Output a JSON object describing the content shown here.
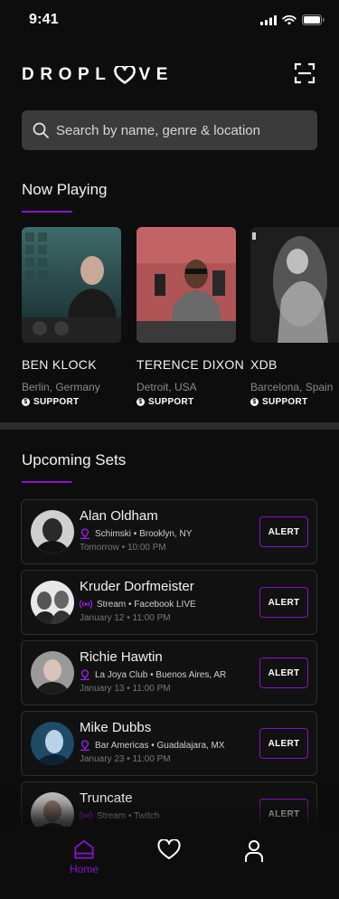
{
  "status_bar": {
    "time": "9:41"
  },
  "header": {
    "logo_text_left": "DROPL",
    "logo_text_right": "VE"
  },
  "search": {
    "placeholder": "Search by name, genre & location"
  },
  "now_playing": {
    "title": "Now Playing",
    "artists": [
      {
        "name": "BEN KLOCK",
        "location": "Berlin, Germany",
        "support_label": "SUPPORT"
      },
      {
        "name": "TERENCE DIXON",
        "location": "Detroit, USA",
        "support_label": "SUPPORT"
      },
      {
        "name": "XDB",
        "location": "Barcelona, Spain",
        "support_label": "SUPPORT"
      }
    ]
  },
  "upcoming_sets": {
    "title": "Upcoming Sets",
    "sets": [
      {
        "name": "Alan Oldham",
        "venue": "Schimski • Brooklyn, NY",
        "venue_icon": "location-pin-icon",
        "date": "Tomorrow • 10:00 PM",
        "button": "ALERT"
      },
      {
        "name": "Kruder Dorfmeister",
        "venue": "Stream • Facebook LIVE",
        "venue_icon": "stream-icon",
        "date": "January 12 • 11:00 PM",
        "button": "ALERT"
      },
      {
        "name": "Richie Hawtin",
        "venue": "La Joya Club • Buenos Aires, AR",
        "venue_icon": "location-pin-icon",
        "date": "January 13 • 11:00 PM",
        "button": "ALERT"
      },
      {
        "name": "Mike Dubbs",
        "venue": "Bar Americas • Guadalajara, MX",
        "venue_icon": "location-pin-icon",
        "date": "January 23 • 11:00 PM",
        "button": "ALERT"
      },
      {
        "name": "Truncate",
        "venue": "Stream • Twitch",
        "venue_icon": "stream-icon",
        "date": "",
        "button": "ALERT"
      }
    ]
  },
  "tab_bar": {
    "home_label": "Home"
  },
  "colors": {
    "accent": "#8b12c8",
    "background": "#0d0d0d",
    "search_bg": "#3b3b3b"
  }
}
